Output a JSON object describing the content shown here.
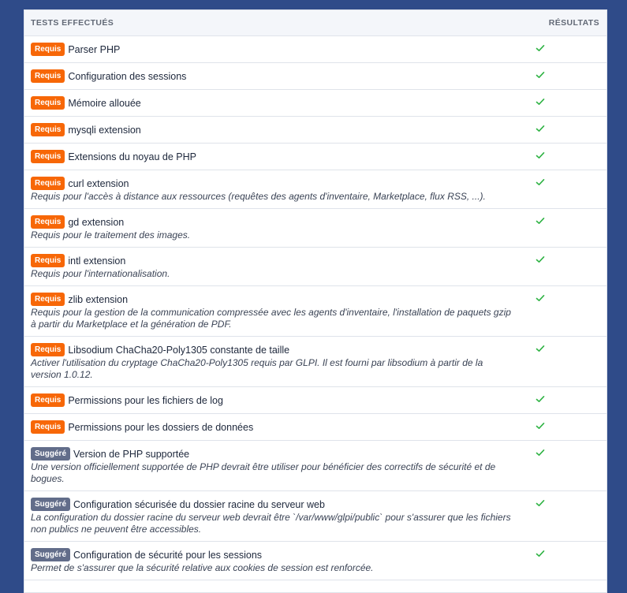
{
  "table": {
    "headers": {
      "tests": "TESTS EFFECTUÉS",
      "results": "RÉSULTATS"
    },
    "colors": {
      "required_badge": "#f76707",
      "suggested_badge": "#626d8a",
      "check": "#2fb344"
    },
    "rows": [
      {
        "badge": "Requis",
        "title": "Parser PHP",
        "desc": "",
        "result": "check-icon"
      },
      {
        "badge": "Requis",
        "title": "Configuration des sessions",
        "desc": "",
        "result": "check-icon"
      },
      {
        "badge": "Requis",
        "title": "Mémoire allouée",
        "desc": "",
        "result": "check-icon"
      },
      {
        "badge": "Requis",
        "title": "mysqli extension",
        "desc": "",
        "result": "check-icon"
      },
      {
        "badge": "Requis",
        "title": "Extensions du noyau de PHP",
        "desc": "",
        "result": "check-icon"
      },
      {
        "badge": "Requis",
        "title": "curl extension",
        "desc": "Requis pour l'accès à distance aux ressources (requêtes des agents d'inventaire, Marketplace, flux RSS, ...).",
        "result": "check-icon"
      },
      {
        "badge": "Requis",
        "title": "gd extension",
        "desc": "Requis pour le traitement des images.",
        "result": "check-icon"
      },
      {
        "badge": "Requis",
        "title": "intl extension",
        "desc": "Requis pour l'internationalisation.",
        "result": "check-icon"
      },
      {
        "badge": "Requis",
        "title": "zlib extension",
        "desc": "Requis pour la gestion de la communication compressée avec les agents d'inventaire, l'installation de paquets gzip à partir du Marketplace et la génération de PDF.",
        "result": "check-icon"
      },
      {
        "badge": "Requis",
        "title": "Libsodium ChaCha20-Poly1305 constante de taille",
        "desc": "Activer l'utilisation du cryptage ChaCha20-Poly1305 requis par GLPI. Il est fourni par libsodium à partir de la version 1.0.12.",
        "result": "check-icon"
      },
      {
        "badge": "Requis",
        "title": "Permissions pour les fichiers de log",
        "desc": "",
        "result": "check-icon"
      },
      {
        "badge": "Requis",
        "title": "Permissions pour les dossiers de données",
        "desc": "",
        "result": "check-icon"
      },
      {
        "badge": "Suggéré",
        "title": "Version de PHP supportée",
        "desc": "Une version officiellement supportée de PHP devrait être utiliser pour bénéficier des correctifs de sécurité et de bogues.",
        "result": "check-icon"
      },
      {
        "badge": "Suggéré",
        "title": "Configuration sécurisée du dossier racine du serveur web",
        "desc": "La configuration du dossier racine du serveur web devrait être `/var/www/glpi/public` pour s'assurer que les fichiers non publics ne peuvent être accessibles.",
        "result": "check-icon"
      },
      {
        "badge": "Suggéré",
        "title": "Configuration de sécurité pour les sessions",
        "desc": "Permet de s'assurer que la sécurité relative aux cookies de session est renforcée.",
        "result": "check-icon"
      }
    ]
  }
}
